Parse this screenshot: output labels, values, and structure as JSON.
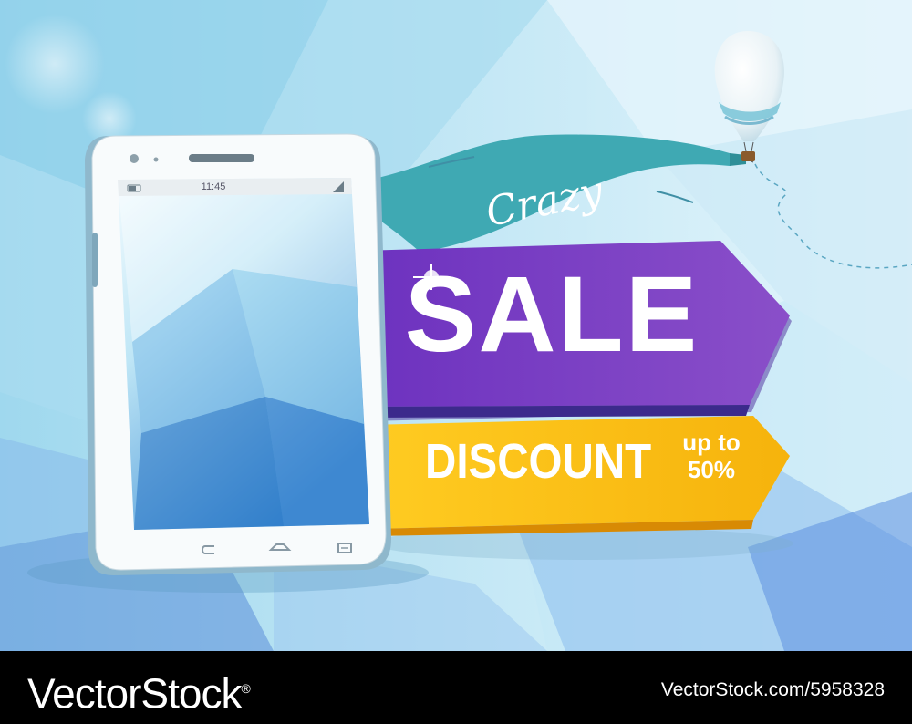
{
  "banner": {
    "ribbon_text": "Crazy",
    "headline": "SALE",
    "discount_label": "DISCOUNT",
    "discount_line1": "up to",
    "discount_line2": "50%"
  },
  "phone": {
    "status_time": "11:45"
  },
  "watermark": {
    "logo": "VectorStock",
    "logo_mark": "®",
    "image_id": "VectorStock.com/5958328"
  },
  "colors": {
    "background": "#bfe6f5",
    "ribbon": "#3fa9b3",
    "sale_banner": "#6a3fc1",
    "discount_banner": "#fbbd1c",
    "footer": "#000000"
  }
}
